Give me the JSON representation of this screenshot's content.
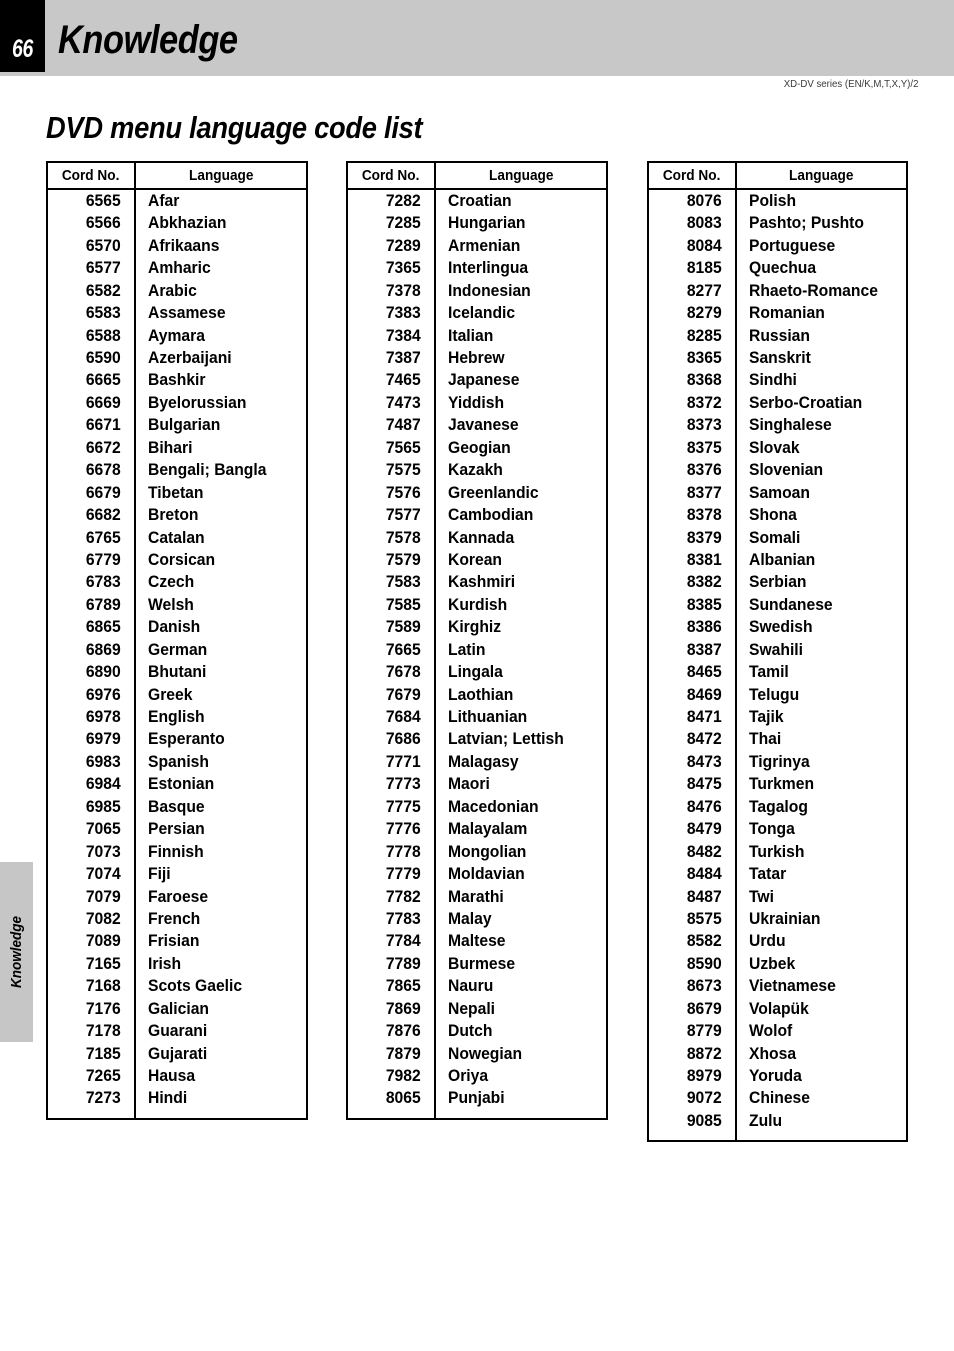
{
  "page": {
    "number": "66",
    "chapter_title": "Knowledge",
    "series_line": "XD-DV series (EN/K,M,T,X,Y)/2",
    "section_title": "DVD menu language code list",
    "side_tab_label": "Knowledge"
  },
  "table_headers": {
    "code": "Cord No.",
    "language": "Language"
  },
  "tables": [
    {
      "id": "table-1",
      "rows": [
        {
          "code": "6565",
          "language": "Afar"
        },
        {
          "code": "6566",
          "language": "Abkhazian"
        },
        {
          "code": "6570",
          "language": "Afrikaans"
        },
        {
          "code": "6577",
          "language": "Amharic"
        },
        {
          "code": "6582",
          "language": "Arabic"
        },
        {
          "code": "6583",
          "language": "Assamese"
        },
        {
          "code": "6588",
          "language": "Aymara"
        },
        {
          "code": "6590",
          "language": "Azerbaijani"
        },
        {
          "code": "6665",
          "language": "Bashkir"
        },
        {
          "code": "6669",
          "language": "Byelorussian"
        },
        {
          "code": "6671",
          "language": "Bulgarian"
        },
        {
          "code": "6672",
          "language": "Bihari"
        },
        {
          "code": "6678",
          "language": "Bengali; Bangla"
        },
        {
          "code": "6679",
          "language": "Tibetan"
        },
        {
          "code": "6682",
          "language": "Breton"
        },
        {
          "code": "6765",
          "language": "Catalan"
        },
        {
          "code": "6779",
          "language": "Corsican"
        },
        {
          "code": "6783",
          "language": "Czech"
        },
        {
          "code": "6789",
          "language": "Welsh"
        },
        {
          "code": "6865",
          "language": "Danish"
        },
        {
          "code": "6869",
          "language": "German"
        },
        {
          "code": "6890",
          "language": "Bhutani"
        },
        {
          "code": "6976",
          "language": "Greek"
        },
        {
          "code": "6978",
          "language": "English"
        },
        {
          "code": "6979",
          "language": "Esperanto"
        },
        {
          "code": "6983",
          "language": "Spanish"
        },
        {
          "code": "6984",
          "language": "Estonian"
        },
        {
          "code": "6985",
          "language": "Basque"
        },
        {
          "code": "7065",
          "language": "Persian"
        },
        {
          "code": "7073",
          "language": "Finnish"
        },
        {
          "code": "7074",
          "language": "Fiji"
        },
        {
          "code": "7079",
          "language": "Faroese"
        },
        {
          "code": "7082",
          "language": "French"
        },
        {
          "code": "7089",
          "language": "Frisian"
        },
        {
          "code": "7165",
          "language": "Irish"
        },
        {
          "code": "7168",
          "language": "Scots Gaelic"
        },
        {
          "code": "7176",
          "language": "Galician"
        },
        {
          "code": "7178",
          "language": "Guarani"
        },
        {
          "code": "7185",
          "language": "Gujarati"
        },
        {
          "code": "7265",
          "language": "Hausa"
        },
        {
          "code": "7273",
          "language": "Hindi"
        }
      ]
    },
    {
      "id": "table-2",
      "rows": [
        {
          "code": "7282",
          "language": "Croatian"
        },
        {
          "code": "7285",
          "language": "Hungarian"
        },
        {
          "code": "7289",
          "language": "Armenian"
        },
        {
          "code": "7365",
          "language": "Interlingua"
        },
        {
          "code": "7378",
          "language": "Indonesian"
        },
        {
          "code": "7383",
          "language": "Icelandic"
        },
        {
          "code": "7384",
          "language": "Italian"
        },
        {
          "code": "7387",
          "language": "Hebrew"
        },
        {
          "code": "7465",
          "language": "Japanese"
        },
        {
          "code": "7473",
          "language": "Yiddish"
        },
        {
          "code": "7487",
          "language": "Javanese"
        },
        {
          "code": "7565",
          "language": "Geogian"
        },
        {
          "code": "7575",
          "language": "Kazakh"
        },
        {
          "code": "7576",
          "language": "Greenlandic"
        },
        {
          "code": "7577",
          "language": "Cambodian"
        },
        {
          "code": "7578",
          "language": "Kannada"
        },
        {
          "code": "7579",
          "language": "Korean"
        },
        {
          "code": "7583",
          "language": "Kashmiri"
        },
        {
          "code": "7585",
          "language": "Kurdish"
        },
        {
          "code": "7589",
          "language": "Kirghiz"
        },
        {
          "code": "7665",
          "language": "Latin"
        },
        {
          "code": "7678",
          "language": "Lingala"
        },
        {
          "code": "7679",
          "language": "Laothian"
        },
        {
          "code": "7684",
          "language": "Lithuanian"
        },
        {
          "code": "7686",
          "language": "Latvian; Lettish"
        },
        {
          "code": "7771",
          "language": "Malagasy"
        },
        {
          "code": "7773",
          "language": "Maori"
        },
        {
          "code": "7775",
          "language": "Macedonian"
        },
        {
          "code": "7776",
          "language": "Malayalam"
        },
        {
          "code": "7778",
          "language": "Mongolian"
        },
        {
          "code": "7779",
          "language": "Moldavian"
        },
        {
          "code": "7782",
          "language": "Marathi"
        },
        {
          "code": "7783",
          "language": "Malay"
        },
        {
          "code": "7784",
          "language": "Maltese"
        },
        {
          "code": "7789",
          "language": "Burmese"
        },
        {
          "code": "7865",
          "language": "Nauru"
        },
        {
          "code": "7869",
          "language": "Nepali"
        },
        {
          "code": "7876",
          "language": "Dutch"
        },
        {
          "code": "7879",
          "language": "Nowegian"
        },
        {
          "code": "7982",
          "language": "Oriya"
        },
        {
          "code": "8065",
          "language": "Punjabi"
        }
      ]
    },
    {
      "id": "table-3",
      "rows": [
        {
          "code": "8076",
          "language": "Polish"
        },
        {
          "code": "8083",
          "language": "Pashto; Pushto"
        },
        {
          "code": "8084",
          "language": "Portuguese"
        },
        {
          "code": "8185",
          "language": "Quechua"
        },
        {
          "code": "8277",
          "language": "Rhaeto-Romance"
        },
        {
          "code": "8279",
          "language": "Romanian"
        },
        {
          "code": "8285",
          "language": "Russian"
        },
        {
          "code": "8365",
          "language": "Sanskrit"
        },
        {
          "code": "8368",
          "language": "Sindhi"
        },
        {
          "code": "8372",
          "language": "Serbo-Croatian"
        },
        {
          "code": "8373",
          "language": "Singhalese"
        },
        {
          "code": "8375",
          "language": "Slovak"
        },
        {
          "code": "8376",
          "language": "Slovenian"
        },
        {
          "code": "8377",
          "language": "Samoan"
        },
        {
          "code": "8378",
          "language": "Shona"
        },
        {
          "code": "8379",
          "language": "Somali"
        },
        {
          "code": "8381",
          "language": "Albanian"
        },
        {
          "code": "8382",
          "language": "Serbian"
        },
        {
          "code": "8385",
          "language": "Sundanese"
        },
        {
          "code": "8386",
          "language": "Swedish"
        },
        {
          "code": "8387",
          "language": "Swahili"
        },
        {
          "code": "8465",
          "language": "Tamil"
        },
        {
          "code": "8469",
          "language": "Telugu"
        },
        {
          "code": "8471",
          "language": "Tajik"
        },
        {
          "code": "8472",
          "language": "Thai"
        },
        {
          "code": "8473",
          "language": "Tigrinya"
        },
        {
          "code": "8475",
          "language": "Turkmen"
        },
        {
          "code": "8476",
          "language": "Tagalog"
        },
        {
          "code": "8479",
          "language": "Tonga"
        },
        {
          "code": "8482",
          "language": "Turkish"
        },
        {
          "code": "8484",
          "language": "Tatar"
        },
        {
          "code": "8487",
          "language": "Twi"
        },
        {
          "code": "8575",
          "language": "Ukrainian"
        },
        {
          "code": "8582",
          "language": "Urdu"
        },
        {
          "code": "8590",
          "language": "Uzbek"
        },
        {
          "code": "8673",
          "language": "Vietnamese"
        },
        {
          "code": "8679",
          "language": "Volapük"
        },
        {
          "code": "8779",
          "language": "Wolof"
        },
        {
          "code": "8872",
          "language": "Xhosa"
        },
        {
          "code": "8979",
          "language": "Yoruda"
        },
        {
          "code": "9072",
          "language": "Chinese"
        },
        {
          "code": "9085",
          "language": "Zulu"
        }
      ]
    }
  ]
}
